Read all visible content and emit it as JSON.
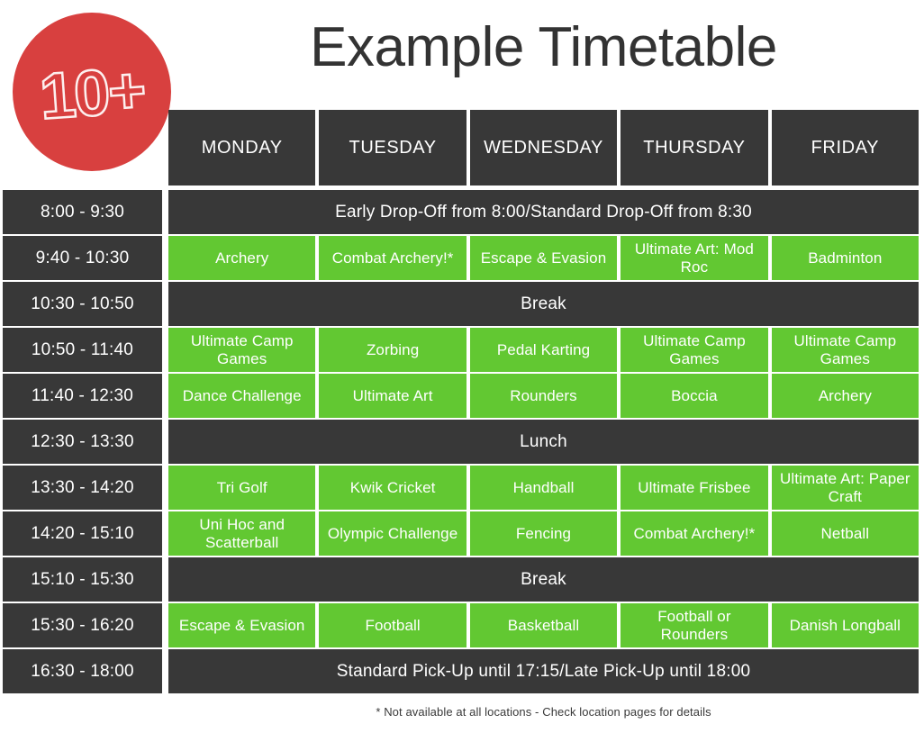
{
  "badge": {
    "label": "10+",
    "circle_color": "#d8403f",
    "text_color": "#ffffff"
  },
  "header": {
    "title": "Example Timetable",
    "title_color": "#333333"
  },
  "colors": {
    "activity": "#62c832",
    "dark": "#383838",
    "accent_red": "#d8403f",
    "background": "#ffffff",
    "text_on_fill": "#ffffff"
  },
  "table": {
    "time_column_header": "",
    "days": [
      "MONDAY",
      "TUESDAY",
      "WEDNESDAY",
      "THURSDAY",
      "FRIDAY"
    ],
    "rows": [
      {
        "time": "8:00 - 9:30",
        "type": "banner",
        "banner": "Early Drop-Off from 8:00/Standard Drop-Off from 8:30"
      },
      {
        "time": "9:40 - 10:30",
        "type": "activities",
        "cells": [
          "Archery",
          "Combat Archery!*",
          "Escape & Evasion",
          "Ultimate Art: Mod Roc",
          "Badminton"
        ]
      },
      {
        "time": "10:30 - 10:50",
        "type": "banner",
        "banner": "Break"
      },
      {
        "time": "10:50 - 11:40",
        "type": "activities",
        "cells": [
          "Ultimate Camp Games",
          "Zorbing",
          "Pedal Karting",
          "Ultimate Camp Games",
          "Ultimate Camp Games"
        ]
      },
      {
        "time": "11:40 - 12:30",
        "type": "activities",
        "cells": [
          "Dance Challenge",
          "Ultimate Art",
          "Rounders",
          "Boccia",
          "Archery"
        ]
      },
      {
        "time": "12:30 - 13:30",
        "type": "banner",
        "banner": "Lunch"
      },
      {
        "time": "13:30 - 14:20",
        "type": "activities",
        "cells": [
          "Tri Golf",
          "Kwik Cricket",
          "Handball",
          "Ultimate Frisbee",
          "Ultimate Art: Paper Craft"
        ]
      },
      {
        "time": "14:20 - 15:10",
        "type": "activities",
        "cells": [
          "Uni Hoc and Scatterball",
          "Olympic Challenge",
          "Fencing",
          "Combat Archery!*",
          "Netball"
        ]
      },
      {
        "time": "15:10 - 15:30",
        "type": "banner",
        "banner": "Break"
      },
      {
        "time": "15:30 - 16:20",
        "type": "activities",
        "cells": [
          "Escape & Evasion",
          "Football",
          "Basketball",
          "Football or Rounders",
          "Danish Longball"
        ]
      },
      {
        "time": "16:30 - 18:00",
        "type": "banner",
        "banner": "Standard Pick-Up until 17:15/Late Pick-Up until 18:00"
      }
    ]
  },
  "footnote": "* Not available at all locations - Check location pages for details"
}
